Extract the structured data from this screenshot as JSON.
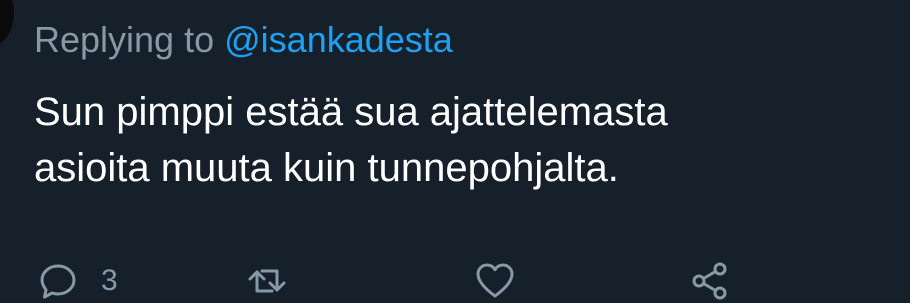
{
  "reply_context": {
    "prefix": "Replying to",
    "handle": "@isankadesta"
  },
  "tweet": {
    "text": "Sun pimppi estää sua ajattelemasta\nasioita muuta kuin tunnepohjalta."
  },
  "actions": {
    "reply_count": "3"
  },
  "colors": {
    "background": "#15202b",
    "secondary_text": "#8899a6",
    "link": "#1da1f2",
    "primary_text": "#ffffff"
  },
  "icons": {
    "reply": "reply-icon",
    "retweet": "retweet-icon",
    "like": "heart-icon",
    "share": "share-icon"
  }
}
